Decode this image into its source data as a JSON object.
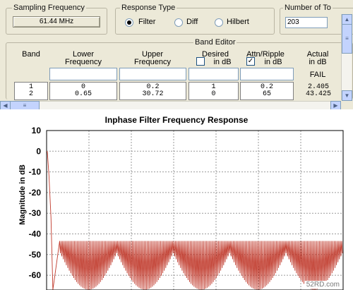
{
  "sampling": {
    "legend": "Sampling Frequency",
    "value": "61.44 MHz"
  },
  "response": {
    "legend": "Response Type",
    "options": [
      {
        "label": "Filter",
        "selected": true
      },
      {
        "label": "Diff",
        "selected": false
      },
      {
        "label": "Hilbert",
        "selected": false
      }
    ]
  },
  "taps": {
    "legend": "Number of To",
    "value": "203"
  },
  "band_editor": {
    "legend": "Band Editor",
    "headers": {
      "band": "Band",
      "lower_1": "Lower",
      "lower_2": "Frequency",
      "upper_1": "Upper",
      "upper_2": "Frequency",
      "desired_1": "Desired",
      "desired_2": "in dB",
      "attn_1": "Attn/Ripple",
      "attn_2": "in dB",
      "actual_1": "Actual",
      "actual_2": "in dB"
    },
    "desired_in_db_checked": false,
    "attn_in_db_checked": true,
    "actual_status": "FAIL",
    "rows": [
      {
        "band": "1",
        "lower": "0",
        "upper": "0.2",
        "desired": "1",
        "attn": "0.2",
        "actual": "2.405"
      },
      {
        "band": "2",
        "lower": "0.65",
        "upper": "30.72",
        "desired": "0",
        "attn": "65",
        "actual": "43.425"
      }
    ]
  },
  "chart_data": {
    "type": "line",
    "title": "Inphase Filter Frequency Response",
    "ylabel": "Magnitude in dB",
    "xlabel": "",
    "yticks": [
      10,
      0,
      -10,
      -20,
      -30,
      -40,
      -50,
      -60
    ],
    "ylim": [
      -67,
      10
    ],
    "x_range": [
      0,
      30.72
    ],
    "grid": true,
    "series": [
      {
        "color": "#c0392b",
        "passband_db": 0,
        "transition_end_x": 0.65,
        "stopband_peak_db": -43.4,
        "stopband_ripple_min_db": -67,
        "stopband_lobes": 5
      }
    ]
  },
  "watermark": "52RD.com"
}
